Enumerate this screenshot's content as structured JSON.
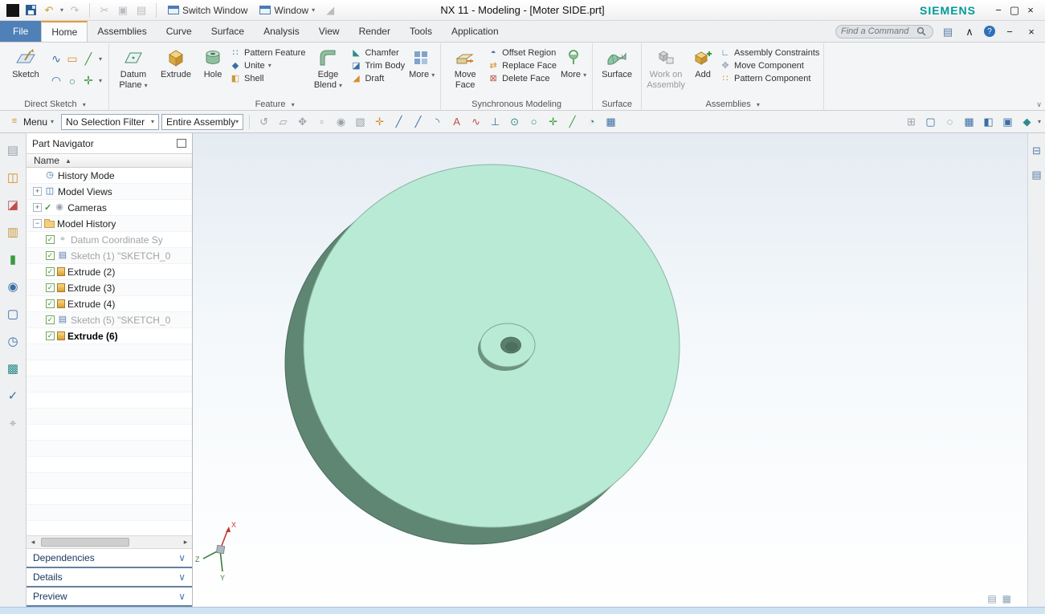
{
  "titlebar": {
    "title": "NX 11 - Modeling - [Moter SIDE.prt]",
    "brand": "SIEMENS",
    "switch_window": "Switch Window",
    "window": "Window"
  },
  "tabbar": {
    "file": "File",
    "tabs": [
      "Home",
      "Assemblies",
      "Curve",
      "Surface",
      "Analysis",
      "View",
      "Render",
      "Tools",
      "Application"
    ],
    "find_placeholder": "Find a Command"
  },
  "ribbon": {
    "direct_sketch": {
      "label": "Direct Sketch",
      "sketch": "Sketch"
    },
    "feature": {
      "label": "Feature",
      "datum": "Datum",
      "plane": "Plane",
      "extrude": "Extrude",
      "hole": "Hole",
      "pattern_feature": "Pattern Feature",
      "unite": "Unite",
      "shell": "Shell",
      "edge": "Edge",
      "blend": "Blend",
      "chamfer": "Chamfer",
      "trim_body": "Trim Body",
      "draft": "Draft",
      "more": "More"
    },
    "synchronous": {
      "label": "Synchronous Modeling",
      "move": "Move",
      "face": "Face",
      "offset_region": "Offset Region",
      "replace_face": "Replace Face",
      "delete_face": "Delete Face",
      "more": "More"
    },
    "surface": {
      "label": "Surface",
      "surface": "Surface"
    },
    "assemblies": {
      "label": "Assemblies",
      "work_on": "Work on",
      "assembly": "Assembly",
      "add": "Add",
      "assembly_constraints": "Assembly Constraints",
      "move_component": "Move Component",
      "pattern_component": "Pattern Component"
    }
  },
  "toolbar": {
    "menu": "Menu",
    "selection_filter": "No Selection Filter",
    "selection_scope": "Entire Assembly",
    "icons": [
      {
        "g": "↺"
      },
      {
        "g": "▱"
      },
      {
        "g": "✥"
      },
      {
        "g": "▫"
      },
      {
        "g": "◉"
      },
      {
        "g": "▧"
      },
      {
        "g": "✛"
      },
      {
        "g": "╱"
      },
      {
        "g": "╱"
      },
      {
        "g": "◝"
      },
      {
        "g": "A"
      },
      {
        "g": "∿"
      },
      {
        "g": "⊥"
      },
      {
        "g": "⊙"
      },
      {
        "g": "○"
      },
      {
        "g": "✛"
      },
      {
        "g": "╱"
      },
      {
        "g": "◔"
      },
      {
        "g": "▦"
      }
    ],
    "right_icons": [
      {
        "g": "⊞"
      },
      {
        "g": "▢"
      },
      {
        "g": "◌"
      },
      {
        "g": "▦"
      },
      {
        "g": "◧"
      },
      {
        "g": "▣"
      },
      {
        "g": "◆"
      }
    ]
  },
  "navigator": {
    "title": "Part Navigator",
    "name_column": "Name",
    "items": [
      {
        "glyph": "◷",
        "label": "History Mode"
      },
      {
        "expand": "+",
        "glyph": "◫",
        "label": "Model Views"
      },
      {
        "expand": "+",
        "check": "✓",
        "glyph": "◉",
        "label": "Cameras"
      },
      {
        "expand": "−",
        "label": "Model History"
      },
      {
        "check": "✓",
        "glyph": "⌖",
        "label": "Datum Coordinate Sy"
      },
      {
        "check": "✓",
        "glyph": "▤",
        "label": "Sketch (1) \"SKETCH_0"
      },
      {
        "check": "✓",
        "label": "Extrude (2)"
      },
      {
        "check": "✓",
        "label": "Extrude (3)"
      },
      {
        "check": "✓",
        "label": "Extrude (4)"
      },
      {
        "check": "✓",
        "glyph": "▤",
        "label": "Sketch (5) \"SKETCH_0"
      },
      {
        "check": "✓",
        "label": "Extrude (6)"
      }
    ],
    "dependencies": "Dependencies",
    "details": "Details",
    "preview": "Preview"
  },
  "leftbar": {
    "icons": [
      {
        "g": "▤"
      },
      {
        "g": "◫"
      },
      {
        "g": "◪"
      },
      {
        "g": "▥"
      },
      {
        "g": "▮"
      },
      {
        "g": "◉"
      },
      {
        "g": "▢"
      },
      {
        "g": "◷"
      },
      {
        "g": "▩"
      },
      {
        "g": "✓"
      },
      {
        "g": "⌖"
      }
    ]
  },
  "rightbar": {
    "icons": [
      {
        "g": "⊟"
      },
      {
        "g": "▤"
      }
    ]
  },
  "viewport": {
    "triad": {
      "x": "X",
      "y": "Y",
      "z": "Z"
    },
    "colors": {
      "face": "#b9ead6",
      "side": "#5f8573",
      "hub_side": "#6d927e",
      "hole": "#5a7f6c",
      "hole_inner": "#4d6f5d"
    },
    "corner_icons": [
      {
        "g": "▤"
      },
      {
        "g": "▦"
      }
    ]
  },
  "minis": [
    "∿",
    "▭",
    "╱",
    "◠",
    "○",
    "✛"
  ],
  "icons": {
    "undo": "↶",
    "redo": "↷",
    "cut": "✂",
    "copy": "▣",
    "paste": "▤",
    "tri": "◢",
    "caret": "▾",
    "chevron": "∨",
    "chevron_up": "∧",
    "sort": "▲",
    "left": "◂",
    "right": "▸",
    "check": "✓",
    "menu": "≡",
    "help": "?",
    "minimize": "−",
    "restore": "▢",
    "close": "×",
    "screen": "▤"
  }
}
